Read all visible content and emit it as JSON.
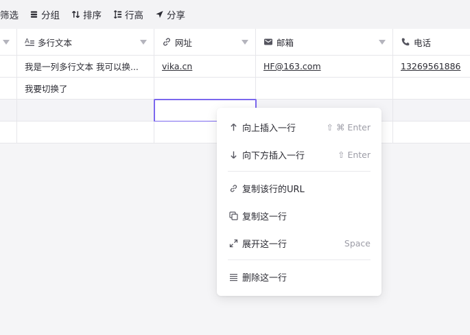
{
  "toolbar": {
    "filter": "筛选",
    "group": "分组",
    "sort": "排序",
    "row_height": "行高",
    "share": "分享"
  },
  "columns": [
    {
      "label": "多行文本",
      "icon": "multiline-text-icon"
    },
    {
      "label": "网址",
      "icon": "link-icon"
    },
    {
      "label": "邮箱",
      "icon": "mail-icon"
    },
    {
      "label": "电话",
      "icon": "phone-icon"
    }
  ],
  "rows": [
    {
      "multiline": "我是一列多行文本 我可以换...",
      "url": "vika.cn",
      "email": "HF@163.com",
      "phone": "13269561886"
    },
    {
      "multiline": "我要切换了",
      "url": "",
      "email": "",
      "phone": ""
    }
  ],
  "context_menu": {
    "insert_above": {
      "label": "向上插入一行",
      "shortcut": "⇧ ⌘ Enter"
    },
    "insert_below": {
      "label": "向下方插入一行",
      "shortcut": "⇧ Enter"
    },
    "copy_url": {
      "label": "复制该行的URL"
    },
    "duplicate": {
      "label": "复制这一行"
    },
    "expand": {
      "label": "展开这一行",
      "shortcut": "Space"
    },
    "delete": {
      "label": "删除这一行"
    }
  },
  "colors": {
    "selection": "#7b67ee",
    "background": "#f5f5f7"
  }
}
